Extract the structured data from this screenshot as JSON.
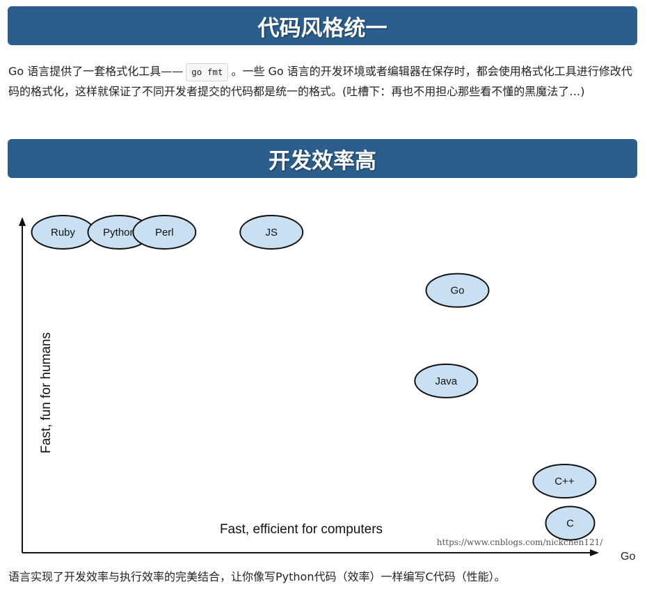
{
  "section1": {
    "title": "代码风格统一"
  },
  "paragraph1": {
    "before_code": "Go 语言提供了一套格式化工具——",
    "code": "go fmt",
    "after_code": "。一些 Go 语言的开发环境或者编辑器在保存时，都会使用格式化工具进行修改代码的格式化，这样就保证了不同开发者提交的代码都是统一的格式。(吐槽下：再也不用担心那些看不懂的黑魔法了…)"
  },
  "section2": {
    "title": "开发效率高"
  },
  "chart_data": {
    "type": "scatter",
    "xlabel": "Fast, efficient for computers",
    "ylabel": "Fast, fun for humans",
    "watermark": "https://www.cnblogs.com/nickchen121/",
    "points": [
      {
        "label": "Ruby",
        "x": 0.05,
        "y": 0.97
      },
      {
        "label": "Python",
        "x": 0.15,
        "y": 0.97
      },
      {
        "label": "Perl",
        "x": 0.23,
        "y": 0.97
      },
      {
        "label": "JS",
        "x": 0.42,
        "y": 0.97
      },
      {
        "label": "Go",
        "x": 0.75,
        "y": 0.79
      },
      {
        "label": "Java",
        "x": 0.73,
        "y": 0.51
      },
      {
        "label": "C++",
        "x": 0.94,
        "y": 0.2
      },
      {
        "label": "C",
        "x": 0.95,
        "y": 0.07
      }
    ],
    "grid": false,
    "legend": "none"
  },
  "paragraph2": {
    "trailing_word": "Go",
    "text": "语言实现了开发效率与执行效率的完美结合，让你像写Python代码（效率）一样编写C代码（性能）。"
  }
}
